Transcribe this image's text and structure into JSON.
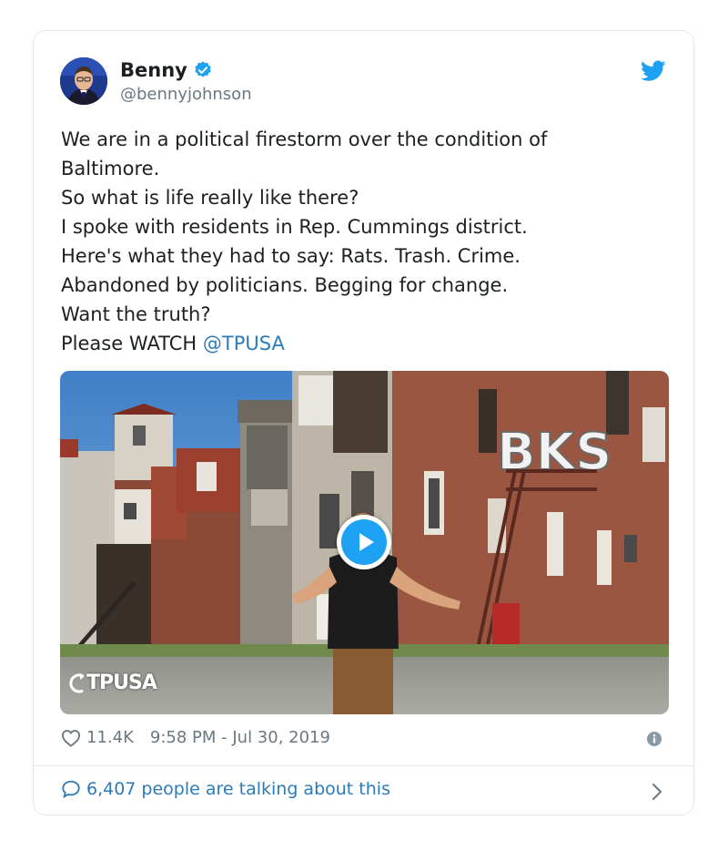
{
  "author": {
    "name": "Benny",
    "handle": "@bennyjohnson"
  },
  "tweet": {
    "lines": [
      "We are in a political firestorm over the condition of",
      "Baltimore.",
      "So what is life really like there?",
      "I spoke with residents in Rep. Cummings district.",
      "Here's what they had to say: Rats. Trash. Crime.",
      "Abandoned by politicians. Begging for change.",
      "Want the truth?"
    ],
    "last_line_prefix": "Please WATCH ",
    "mention": "@TPUSA"
  },
  "media": {
    "watermark": "TPUSA",
    "graffiti": "BKS",
    "play_icon": "play-icon"
  },
  "meta": {
    "likes": "11.4K",
    "timestamp": "9:58 PM - Jul 30, 2019"
  },
  "footer": {
    "talking": "6,407 people are talking about this"
  },
  "icons": [
    "verified-badge-icon",
    "twitter-bird-icon",
    "heart-icon",
    "info-icon",
    "comment-bubble-icon",
    "chevron-right-icon"
  ],
  "colors": {
    "accent": "#1da1f2",
    "link": "#2b7bb9",
    "muted": "#697882",
    "text": "#1c2022"
  }
}
